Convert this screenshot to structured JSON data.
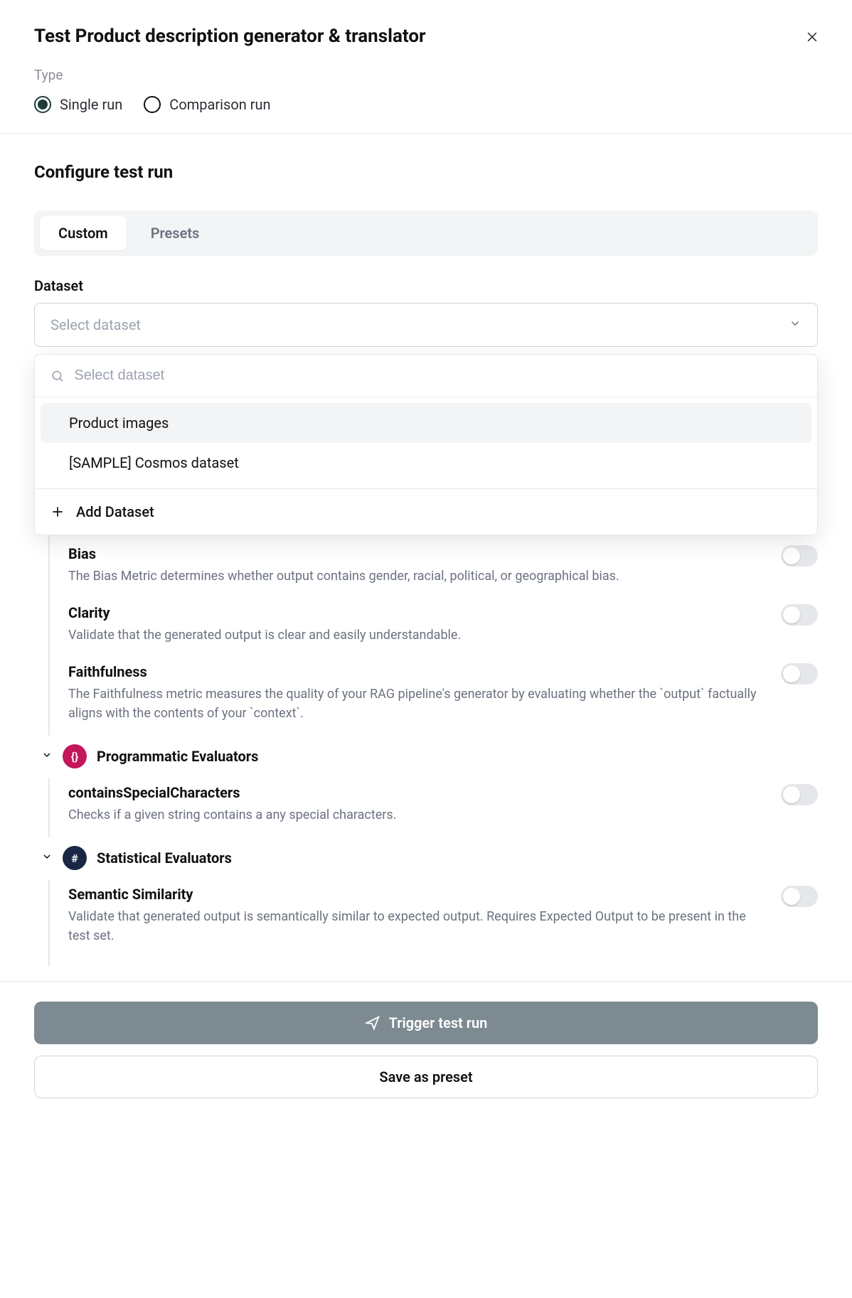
{
  "header": {
    "title": "Test Product description generator & translator",
    "type_label": "Type",
    "radios": {
      "single": "Single run",
      "comparison": "Comparison run"
    }
  },
  "section": {
    "title": "Configure test run",
    "tabs": {
      "custom": "Custom",
      "presets": "Presets"
    }
  },
  "dataset": {
    "label": "Dataset",
    "placeholder": "Select dataset",
    "search_placeholder": "Select dataset",
    "options": [
      "Product images",
      "[SAMPLE] Cosmos dataset"
    ],
    "add_label": "Add Dataset"
  },
  "evaluators": {
    "llm": [
      {
        "name": "Bias",
        "desc": "The Bias Metric determines whether output contains gender, racial, political, or geographical bias."
      },
      {
        "name": "Clarity",
        "desc": "Validate that the generated output is clear and easily understandable."
      },
      {
        "name": "Faithfulness",
        "desc": "The Faithfulness metric measures the quality of your RAG pipeline's generator by evaluating whether the `output` factually aligns with the contents of your `context`."
      }
    ],
    "programmatic": {
      "group_title": "Programmatic Evaluators",
      "badge": "{}",
      "items": [
        {
          "name": "containsSpecialCharacters",
          "desc": "Checks if a given string contains a any special characters."
        }
      ]
    },
    "statistical": {
      "group_title": "Statistical Evaluators",
      "badge": "#",
      "items": [
        {
          "name": "Semantic Similarity",
          "desc": "Validate that generated output is semantically similar to expected output. Requires Expected Output to be present in the test set."
        }
      ]
    }
  },
  "footer": {
    "trigger": "Trigger test run",
    "save": "Save as preset"
  }
}
